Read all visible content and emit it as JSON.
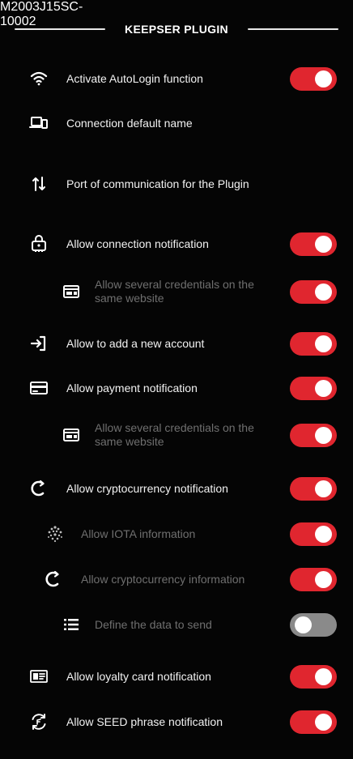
{
  "header": {
    "title": "KEEPSER PLUGIN"
  },
  "settings": {
    "autologin": {
      "label": "Activate AutoLogin function",
      "enabled": true
    },
    "connection_name": {
      "label": "Connection default name",
      "value": "M2003J15SC-"
    },
    "port": {
      "label": "Port of communication for the Plugin",
      "value": "10002"
    },
    "connection_notification": {
      "label": "Allow connection notification",
      "enabled": true
    },
    "several_credentials_1": {
      "label": "Allow several credentials on the same website",
      "enabled": true
    },
    "add_account": {
      "label": "Allow to add a new account",
      "enabled": true
    },
    "payment_notification": {
      "label": "Allow payment notification",
      "enabled": true
    },
    "several_credentials_2": {
      "label": "Allow several credentials on the same website",
      "enabled": true
    },
    "crypto_notification": {
      "label": "Allow cryptocurrency notification",
      "enabled": true
    },
    "iota_information": {
      "label": "Allow IOTA information",
      "enabled": true
    },
    "crypto_information": {
      "label": "Allow cryptocurrency information",
      "enabled": true
    },
    "define_data": {
      "label": "Define the data to send",
      "enabled": false
    },
    "loyalty_card": {
      "label": "Allow loyalty card notification",
      "enabled": true
    },
    "seed_phrase": {
      "label": "Allow SEED phrase notification",
      "enabled": true
    }
  },
  "colors": {
    "toggle_on": "#e0262f",
    "toggle_off": "#8a8a8a",
    "background": "#050505",
    "sub_text": "#6f6f6f"
  },
  "icons": {
    "autologin": "wifi-icon",
    "connection_name": "devices-icon",
    "port": "swap-vertical-icon",
    "connection_notification": "lock-device-icon",
    "several_credentials": "credentials-card-icon",
    "add_account": "login-icon",
    "payment_notification": "credit-card-icon",
    "crypto_notification": "crypto-cycle-icon",
    "iota_information": "iota-icon",
    "crypto_information": "crypto-cycle-icon",
    "define_data": "list-icon",
    "loyalty_card": "id-card-icon",
    "seed_phrase": "seed-refresh-icon"
  }
}
